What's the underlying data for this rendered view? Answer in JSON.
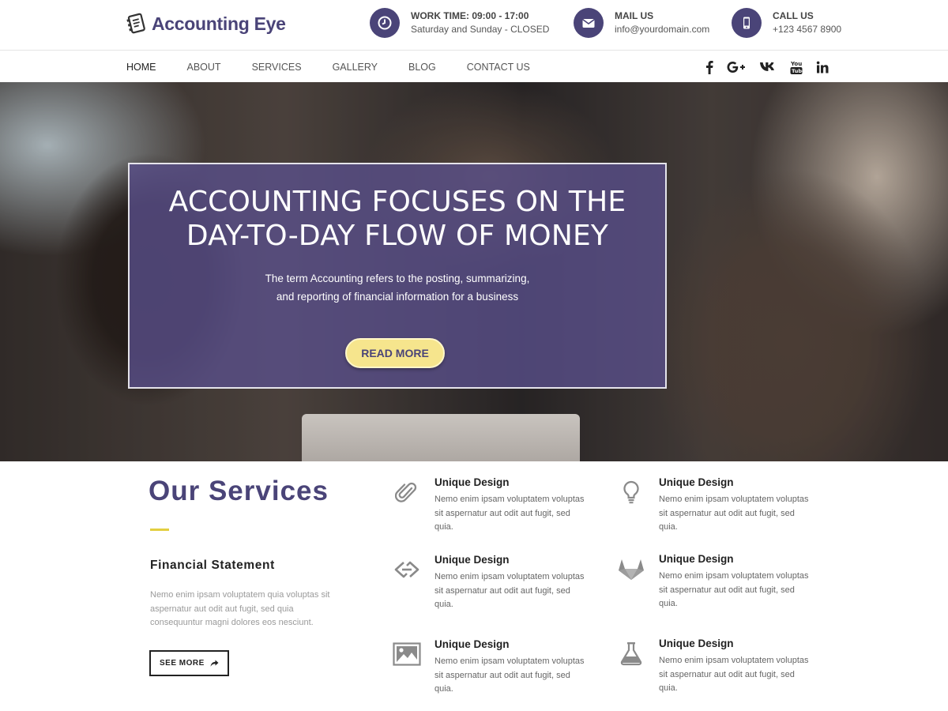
{
  "header": {
    "logo_text": "Accounting Eye",
    "work": {
      "title": "WORK TIME: 09:00 - 17:00",
      "sub": "Saturday and Sunday - CLOSED",
      "icon": "clock-icon"
    },
    "mail": {
      "title": "MAIL US",
      "sub": "info@yourdomain.com",
      "icon": "envelope-icon"
    },
    "call": {
      "title": "CALL US",
      "sub": "+123 4567 8900",
      "icon": "mobile-phone-icon"
    },
    "accent_color": "#4a4478"
  },
  "nav": {
    "items": [
      "HOME",
      "ABOUT",
      "SERVICES",
      "GALLERY",
      "BLOG",
      "CONTACT US"
    ],
    "active": "HOME",
    "socials": [
      "facebook-icon",
      "google-plus-icon",
      "vk-icon",
      "youtube-icon",
      "linkedin-icon"
    ]
  },
  "hero": {
    "title_line1": "ACCOUNTING FOCUSES ON THE",
    "title_line2": "DAY-TO-DAY FLOW OF MONEY",
    "text": "The term Accounting refers to the posting, summarizing, and reporting of financial information for a business",
    "button": "READ MORE",
    "button_color": "#f6e58d"
  },
  "services": {
    "heading": "Our Services",
    "feature_title": "Financial Statement",
    "feature_text": "Nemo enim ipsam voluptatem quia voluptas sit aspernatur aut odit aut fugit, sed quia consequuntur magni dolores eos nesciunt.",
    "see_more": "SEE MORE",
    "items": [
      {
        "title": "Unique Design",
        "text": "Nemo enim ipsam voluptatem voluptas sit aspernatur aut odit aut fugit, sed quia.",
        "icon": "paperclip-icon"
      },
      {
        "title": "Unique Design",
        "text": "Nemo enim ipsam voluptatem voluptas sit aspernatur aut odit aut fugit, sed quia.",
        "icon": "lightbulb-icon"
      },
      {
        "title": "Unique Design",
        "text": "Nemo enim ipsam voluptatem voluptas sit aspernatur aut odit aut fugit, sed quia.",
        "icon": "code-brackets-icon"
      },
      {
        "title": "Unique Design",
        "text": "Nemo enim ipsam voluptatem voluptas sit aspernatur aut odit aut fugit, sed quia.",
        "icon": "gitlab-fox-icon"
      },
      {
        "title": "Unique Design",
        "text": "Nemo enim ipsam voluptatem voluptas sit aspernatur aut odit aut fugit, sed quia.",
        "icon": "image-icon"
      },
      {
        "title": "Unique Design",
        "text": "Nemo enim ipsam voluptatem voluptas sit aspernatur aut odit aut fugit, sed quia.",
        "icon": "flask-icon"
      }
    ]
  }
}
